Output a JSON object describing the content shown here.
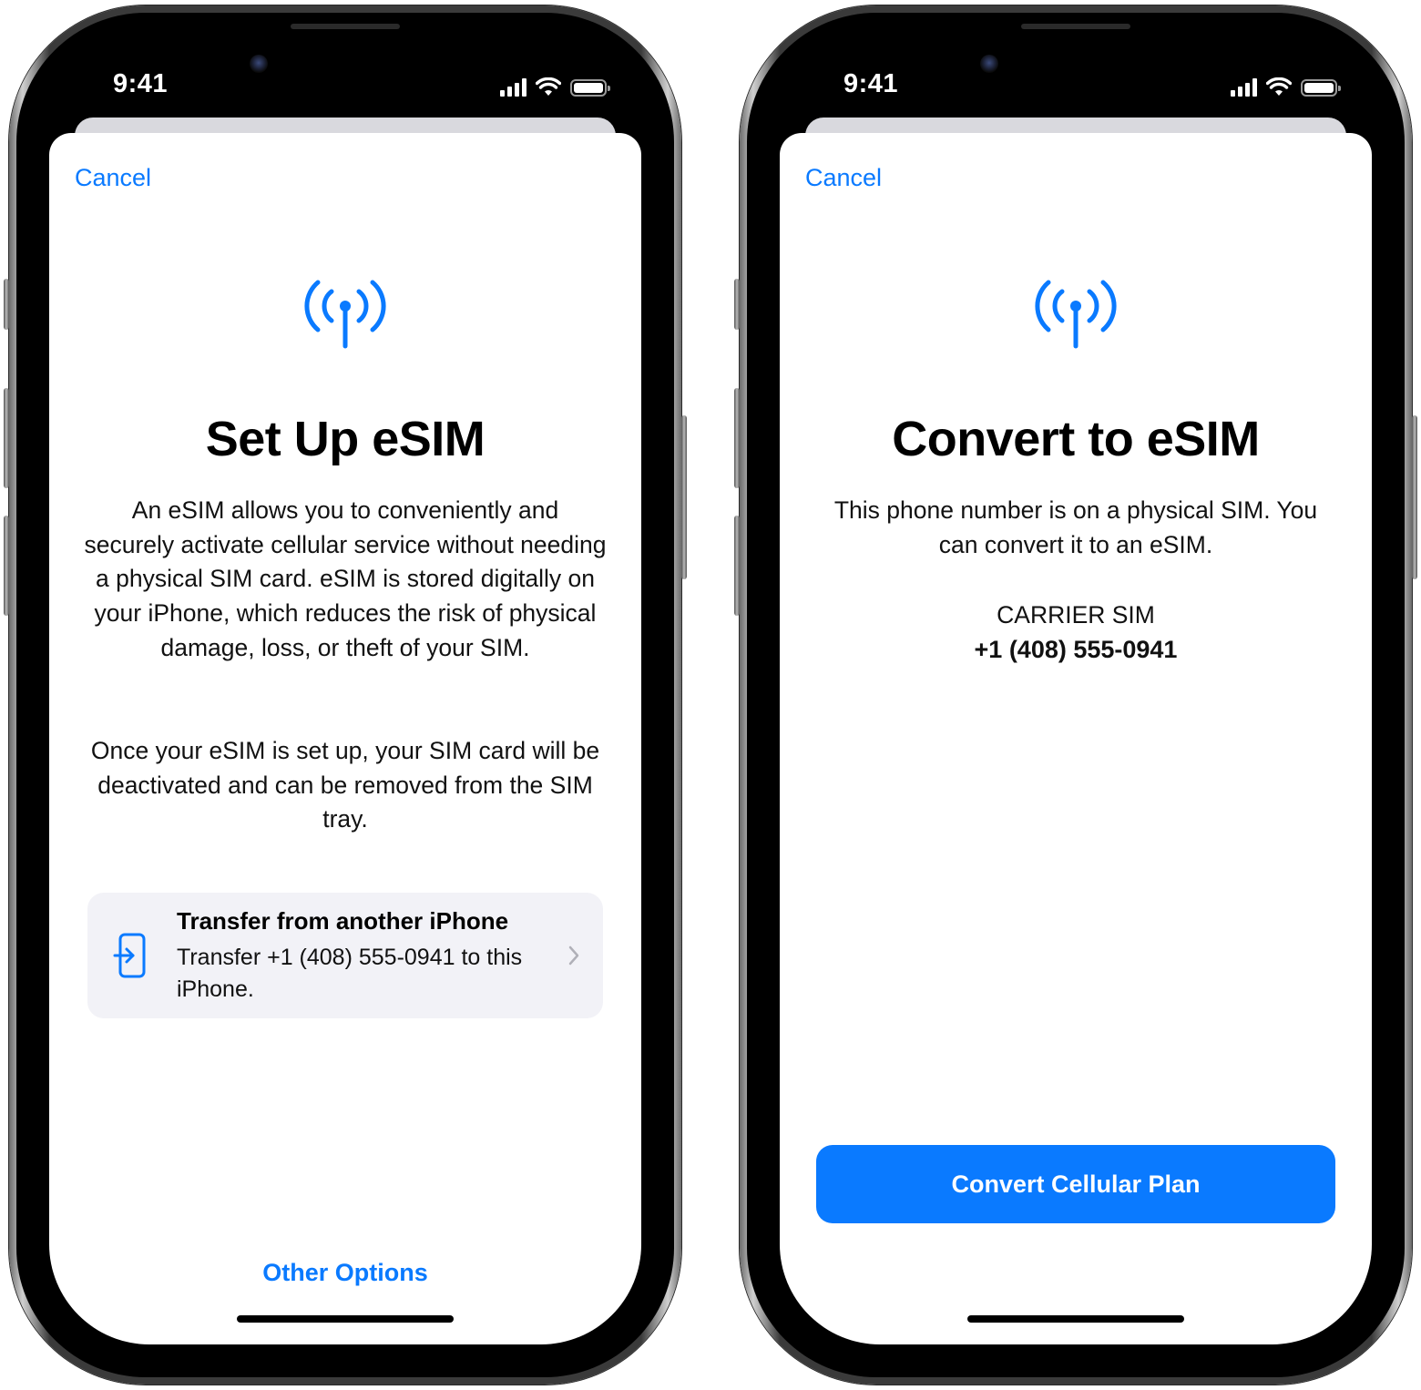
{
  "status_bar": {
    "time": "9:41"
  },
  "colors": {
    "accent": "#0a7aff",
    "sheet_bg": "#ffffff",
    "card_bg": "#f2f2f7"
  },
  "icons": [
    "antenna-icon",
    "signal-icon",
    "wifi-icon",
    "battery-icon",
    "transfer-icon",
    "chevron-right-icon"
  ],
  "left_screen": {
    "cancel_label": "Cancel",
    "title": "Set Up eSIM",
    "paragraph1": "An eSIM allows you to conveniently and securely activate cellular service without needing a physical SIM card. eSIM is stored digitally on your iPhone, which reduces the risk of physical damage, loss, or theft of your SIM.",
    "paragraph2": "Once your eSIM is set up, your SIM card will be deactivated and can be removed from the SIM tray.",
    "transfer": {
      "title": "Transfer from another iPhone",
      "subtitle": "Transfer +1 (408) 555-0941 to this iPhone."
    },
    "other_options_label": "Other Options"
  },
  "right_screen": {
    "cancel_label": "Cancel",
    "title": "Convert to eSIM",
    "description": "This phone number is on a physical SIM. You can convert it to an eSIM.",
    "carrier_label": "CARRIER SIM",
    "phone_number": "+1 (408) 555-0941",
    "convert_button_label": "Convert Cellular Plan"
  }
}
